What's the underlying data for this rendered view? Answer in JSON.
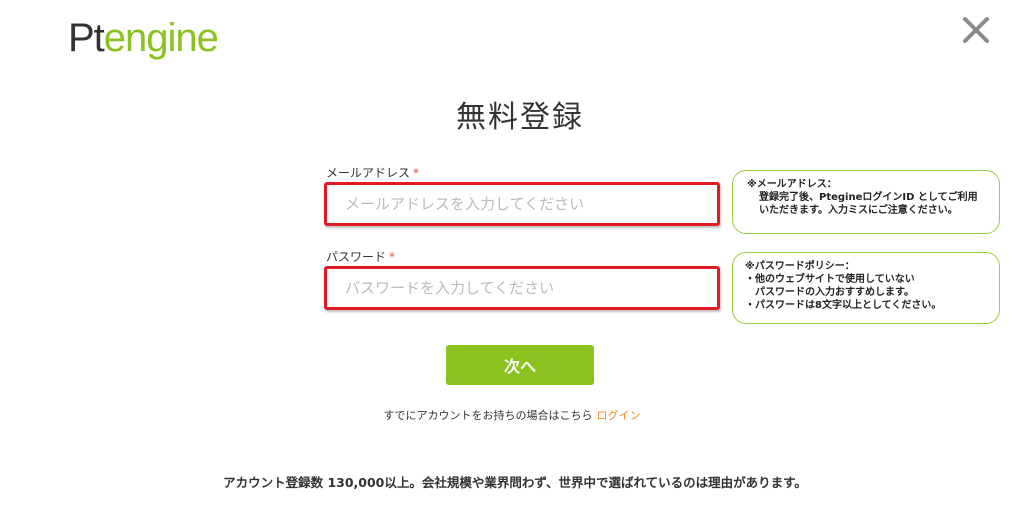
{
  "logo": {
    "part1": "Pt",
    "part2": "engine"
  },
  "title": "無料登録",
  "email": {
    "label": "メールアドレス",
    "required_mark": "*",
    "placeholder": "メールアドレスを入力してください",
    "hint": {
      "line1": "※メールアドレス：",
      "line2": "登録完了後、PtegineログインID としてご利用",
      "line3": "いただきます。入力ミスにご注意ください。"
    }
  },
  "password": {
    "label": "パスワード",
    "required_mark": "*",
    "placeholder": "パスワードを入力してください",
    "hint": {
      "line1": "※パスワードポリシー：",
      "line2": "・他のウェブサイトで使用していない",
      "line3": "パスワードの入力おすすめします。",
      "line4": "・パスワードは8文字以上としてください。"
    }
  },
  "next_button": "次へ",
  "login_prompt": {
    "text": "すでにアカウントをお持ちの場合はこちら",
    "link": "ログイン"
  },
  "footer": "アカウント登録数 130,000以上。会社規模や業界問わず、世界中で選ばれているのは理由があります。",
  "colors": {
    "brand_green": "#8cc21f",
    "error_red": "#e01b24",
    "link_orange": "#f08a24"
  },
  "icons": {
    "close": "close-icon"
  }
}
